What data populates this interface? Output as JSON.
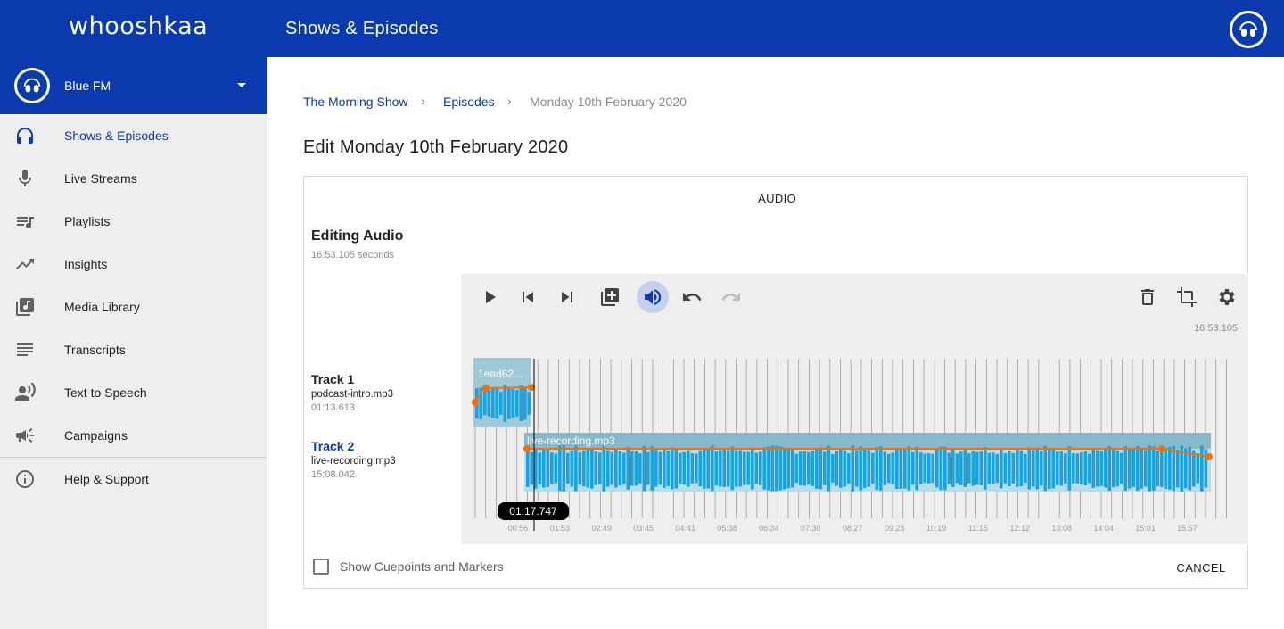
{
  "app": {
    "logo_text": "whooshkaa",
    "header_title": "Shows & Episodes",
    "brand_color": "#0a3aad"
  },
  "station": {
    "name": "Blue FM"
  },
  "sidebar": {
    "items": [
      {
        "label": "Shows & Episodes",
        "icon": "headphones-icon",
        "active": true
      },
      {
        "label": "Live Streams",
        "icon": "microphone-icon",
        "active": false
      },
      {
        "label": "Playlists",
        "icon": "playlist-icon",
        "active": false
      },
      {
        "label": "Insights",
        "icon": "trending-up-icon",
        "active": false
      },
      {
        "label": "Media Library",
        "icon": "library-music-icon",
        "active": false
      },
      {
        "label": "Transcripts",
        "icon": "notes-icon",
        "active": false
      },
      {
        "label": "Text to Speech",
        "icon": "speaking-person-icon",
        "active": false
      },
      {
        "label": "Campaigns",
        "icon": "megaphone-icon",
        "active": false
      }
    ],
    "help": {
      "label": "Help & Support",
      "icon": "info-icon"
    }
  },
  "breadcrumb": {
    "show": "The Morning Show",
    "episodes": "Episodes",
    "current": "Monday 10th February 2020",
    "separator": "›"
  },
  "page": {
    "title": "Edit Monday 10th February 2020"
  },
  "card": {
    "tab": "AUDIO",
    "editing_title": "Editing Audio",
    "editing_sub": "16:53.105 seconds"
  },
  "toolbar": {
    "buttons": [
      {
        "icon": "play-icon"
      },
      {
        "icon": "skip-previous-icon"
      },
      {
        "icon": "skip-next-icon"
      },
      {
        "icon": "add-track-icon"
      },
      {
        "icon": "volume-icon",
        "active": true
      },
      {
        "icon": "undo-icon"
      },
      {
        "icon": "redo-icon",
        "disabled": true
      },
      {
        "icon": "delete-icon"
      },
      {
        "icon": "crop-icon"
      },
      {
        "icon": "settings-icon"
      }
    ],
    "total_time": "16:53.105"
  },
  "tracks": [
    {
      "name": "Track 1",
      "file": "podcast-intro.mp3",
      "duration": "01:13.613",
      "clip_label": "1ead62...",
      "selected": false
    },
    {
      "name": "Track 2",
      "file": "live-recording.mp3",
      "duration": "15:08.042",
      "clip_label": "live-recording.mp3",
      "selected": true
    }
  ],
  "timeline": {
    "playhead_time": "01:17.747",
    "ticks": [
      "00:56",
      "01:53",
      "02:49",
      "03:45",
      "04:41",
      "05:38",
      "06:34",
      "07:30",
      "08:27",
      "09:23",
      "10:19",
      "11:15",
      "12:12",
      "13:08",
      "14:04",
      "15:01",
      "15:57"
    ]
  },
  "footer": {
    "cue_label": "Show Cuepoints and Markers",
    "cancel_label": "CANCEL"
  }
}
